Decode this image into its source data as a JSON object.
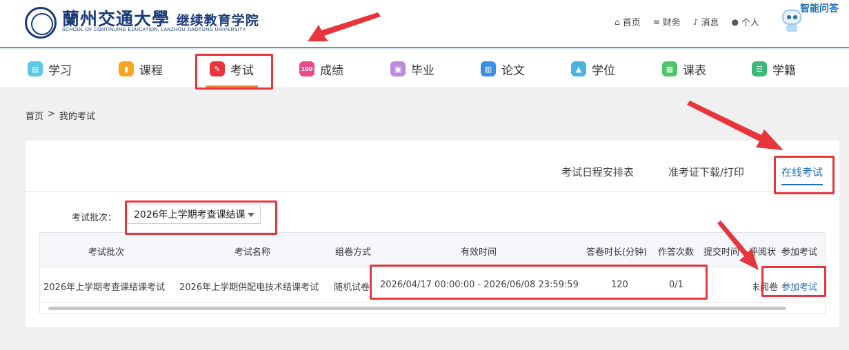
{
  "header": {
    "logo_cn_main": "蘭州交通大學",
    "logo_cn_sub": "继续教育学院",
    "logo_en": "SCHOOL OF CONTINUING EDUCATION, LANZHOU JIAOTONG UNIVERSITY",
    "links": [
      {
        "label": "首页",
        "icon": "home-icon"
      },
      {
        "label": "财务",
        "icon": "database-icon"
      },
      {
        "label": "消息",
        "icon": "bell-icon"
      },
      {
        "label": "个人",
        "icon": "user-icon"
      }
    ],
    "ai_label": "智能问答"
  },
  "nav": {
    "items": [
      {
        "label": "学习",
        "icon": "study-icon",
        "color": "#5bc8e8"
      },
      {
        "label": "课程",
        "icon": "book-icon",
        "color": "#f5a623"
      },
      {
        "label": "考试",
        "icon": "exam-pen-icon",
        "color": "#e8353b"
      },
      {
        "label": "成绩",
        "icon": "score-icon",
        "color": "#e84a8a"
      },
      {
        "label": "毕业",
        "icon": "graduate-icon",
        "color": "#b98ae0"
      },
      {
        "label": "论文",
        "icon": "document-icon",
        "color": "#3a8ee6"
      },
      {
        "label": "学位",
        "icon": "cap-icon",
        "color": "#4ab3e0"
      },
      {
        "label": "课表",
        "icon": "calendar-icon",
        "color": "#4cc46a"
      },
      {
        "label": "学籍",
        "icon": "record-icon",
        "color": "#3cb878"
      }
    ],
    "active_index": 2
  },
  "breadcrumb": {
    "home": "首页",
    "separator": ">",
    "current": "我的考试"
  },
  "tabs": [
    "考试日程安排表",
    "准考证下载/打印",
    "在线考试"
  ],
  "filter": {
    "label": "考试批次：",
    "selected": "2026年上学期考查课结课"
  },
  "table": {
    "headers": [
      "考试批次",
      "考试名称",
      "组卷方式",
      "有效时间",
      "答卷时长(分钟)",
      "作答次数",
      "提交时间",
      "评阅状",
      "参加考试"
    ],
    "rows": [
      [
        "2026年上学期考查课结课考试",
        "2026年上学期供配电技术结课考试",
        "随机试卷",
        "2026/04/17 00:00:00 - 2026/06/08 23:59:59",
        "120",
        "0/1",
        "",
        "未阅卷",
        "参加考试"
      ]
    ]
  },
  "colors": {
    "accent": "#1f6fb5",
    "header_line": "#2ba6d8",
    "annotation": "#e8353b",
    "active_tab_underline": "#f08a3c"
  }
}
